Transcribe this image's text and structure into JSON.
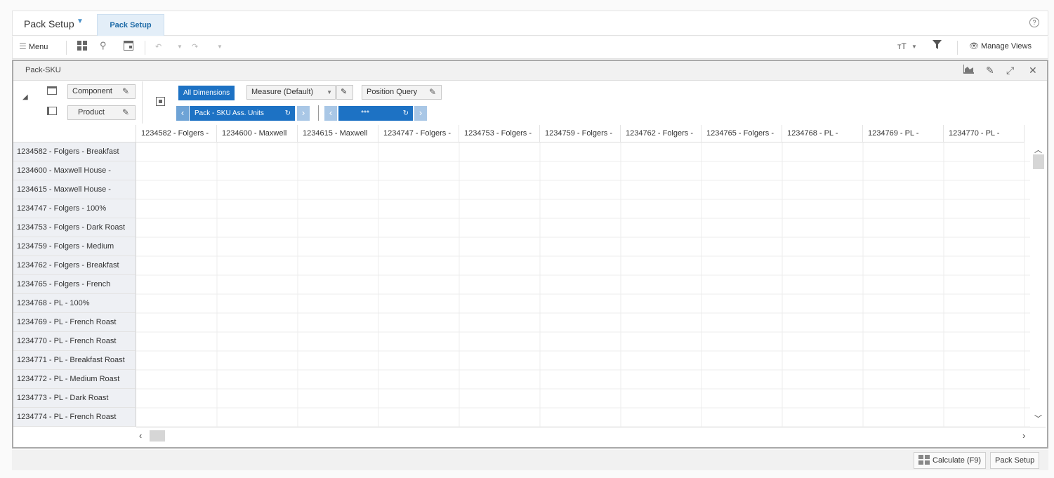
{
  "app": {
    "title": "Pack Setup",
    "active_tab": "Pack Setup",
    "help_icon": "?"
  },
  "toolbar": {
    "menu_label": "Menu",
    "manage_views_label": "Manage Views"
  },
  "panel": {
    "title": "Pack-SKU"
  },
  "controls": {
    "component_label": "Component",
    "product_label": "Product",
    "all_dimensions_label": "All Dimensions",
    "measure_label": "Measure (Default)",
    "position_query_label": "Position Query",
    "measure_nav_label": "Pack - SKU Ass. Units",
    "position_nav_label": "***"
  },
  "grid": {
    "columns": [
      "1234582 - Folgers -",
      "1234600 - Maxwell",
      "1234615 - Maxwell",
      "1234747 - Folgers -",
      "1234753 - Folgers -",
      "1234759 - Folgers -",
      "1234762 - Folgers -",
      "1234765 - Folgers -",
      "1234768 - PL -",
      "1234769 - PL -",
      "1234770 - PL -"
    ],
    "rows": [
      "1234582 - Folgers - Breakfast",
      "1234600 - Maxwell House -",
      "1234615 - Maxwell House -",
      "1234747 - Folgers - 100%",
      "1234753 - Folgers - Dark Roast",
      "1234759 - Folgers - Medium",
      "1234762 - Folgers - Breakfast",
      "1234765 - Folgers - French",
      "1234768 - PL - 100%",
      "1234769 - PL - French Roast",
      "1234770 - PL - French Roast",
      "1234771 - PL - Breakfast Roast",
      "1234772 - PL - Medium Roast",
      "1234773 - PL - Dark Roast",
      "1234774 - PL - French Roast"
    ]
  },
  "statusbar": {
    "calculate_label": "Calculate (F9)",
    "pack_setup_label": "Pack Setup"
  },
  "colors": {
    "accent": "#1d72c4",
    "tab_active_bg": "#e3eef8",
    "row_header_bg": "#eef0f4"
  }
}
